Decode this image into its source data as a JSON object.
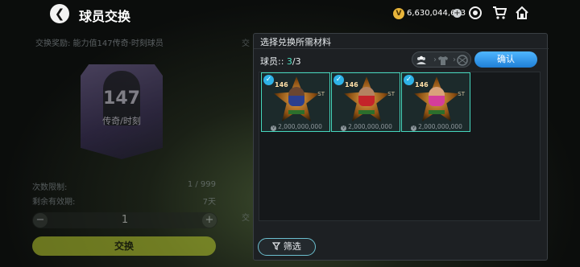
{
  "header": {
    "title": "球员交换",
    "coins": "6,630,044,623",
    "coin_symbol": "V",
    "back_glyph": "❮"
  },
  "left_panel": {
    "reward_label": "交换奖励: 能力值147传奇·时刻球员",
    "reward_rating": "147",
    "reward_type": "传奇/时刻",
    "limit_label": "次数限制:",
    "limit_value": "1 / 999",
    "expiry_label": "剩余有效期:",
    "expiry_value": "7天",
    "quantity": "1",
    "minus": "−",
    "plus": "+",
    "exchange_label": "交换"
  },
  "mid_hints": {
    "top": "交",
    "bottom": "交"
  },
  "modal": {
    "title": "选择兑换所需材料",
    "count_prefix": "球员:: ",
    "count_current": "3",
    "count_total": "/3",
    "confirm_label": "确认",
    "filter_label": "筛选",
    "cards": [
      {
        "rating": "146",
        "position": "ST",
        "price": "2,000,000,000",
        "skin": "#6b4630",
        "jersey": "#2b3f8f"
      },
      {
        "rating": "146",
        "position": "ST",
        "price": "2,000,000,000",
        "skin": "#b48260",
        "jersey": "#c4242a"
      },
      {
        "rating": "146",
        "position": "ST",
        "price": "2,000,000,000",
        "skin": "#d9a27a",
        "jersey": "#d43e9a"
      }
    ]
  },
  "icons": {
    "coin_add": "+",
    "check": "✓",
    "price_coin": "V",
    "filter": "⏃"
  }
}
